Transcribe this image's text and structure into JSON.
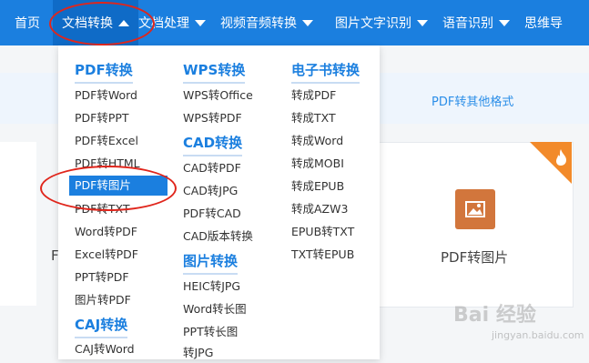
{
  "nav": {
    "items": [
      {
        "label": "首页"
      },
      {
        "label": "文档转换"
      },
      {
        "label": "文档处理"
      },
      {
        "label": "视频音频转换"
      },
      {
        "label": "图片文字识别"
      },
      {
        "label": "语音识别"
      },
      {
        "label": "思维导"
      }
    ]
  },
  "background": {
    "band_link": "PDF转其他格式",
    "card_title": "PDF转图片",
    "left_stub": "F"
  },
  "dropdown": {
    "col1": {
      "header": "PDF转换",
      "items": [
        "PDF转Word",
        "PDF转PPT",
        "PDF转Excel",
        "PDF转HTML",
        "PDF转图片",
        "PDF转TXT",
        "Word转PDF",
        "Excel转PDF",
        "PPT转PDF",
        "图片转PDF"
      ],
      "header2": "CAJ转换",
      "items2": [
        "CAJ转Word"
      ]
    },
    "col2": {
      "header": "WPS转换",
      "items": [
        "WPS转Office",
        "WPS转PDF"
      ],
      "header2": "CAD转换",
      "items2": [
        "CAD转PDF",
        "CAD转JPG",
        "PDF转CAD",
        "CAD版本转换"
      ],
      "header3": "图片转换",
      "items3": [
        "HEIC转JPG",
        "Word转长图",
        "PPT转长图",
        "转JPG"
      ]
    },
    "col3": {
      "header": "电子书转换",
      "items": [
        "转成PDF",
        "转成TXT",
        "转成Word",
        "转成MOBI",
        "转成EPUB",
        "转成AZW3",
        "EPUB转TXT",
        "TXT转EPUB"
      ]
    }
  },
  "colors": {
    "nav_bg": "#1b7fdf",
    "accent": "#1b7fdf",
    "annotation": "#e0261c",
    "hot": "#f28a2a"
  },
  "watermark": {
    "main": "Bai 经验",
    "sub": "jingyan.baidu.com"
  }
}
